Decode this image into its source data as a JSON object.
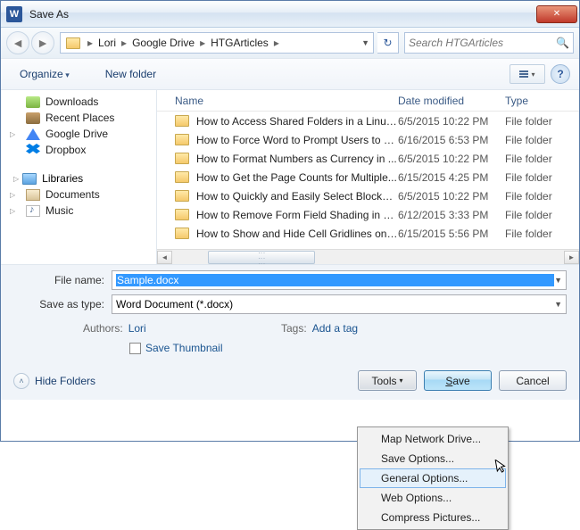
{
  "titlebar": {
    "title": "Save As",
    "app_glyph": "W"
  },
  "breadcrumb": [
    "Lori",
    "Google Drive",
    "HTGArticles"
  ],
  "search": {
    "placeholder": "Search HTGArticles"
  },
  "toolbar": {
    "organize": "Organize",
    "newfolder": "New folder"
  },
  "tree": {
    "top": [
      {
        "label": "Downloads",
        "icon": "dl"
      },
      {
        "label": "Recent Places",
        "icon": "recent"
      },
      {
        "label": "Google Drive",
        "icon": "gdrive"
      },
      {
        "label": "Dropbox",
        "icon": "dropbox"
      }
    ],
    "lib_header": "Libraries",
    "libs": [
      {
        "label": "Documents",
        "icon": "doc"
      },
      {
        "label": "Music",
        "icon": "music"
      }
    ]
  },
  "columns": {
    "name": "Name",
    "date": "Date modified",
    "type": "Type"
  },
  "files": [
    {
      "name": "How to Access Shared Folders in a Linux ...",
      "date": "6/5/2015 10:22 PM",
      "type": "File folder"
    },
    {
      "name": "How to Force Word to Prompt Users to O...",
      "date": "6/16/2015 6:53 PM",
      "type": "File folder"
    },
    {
      "name": "How to Format Numbers as Currency in ...",
      "date": "6/5/2015 10:22 PM",
      "type": "File folder"
    },
    {
      "name": "How to Get the Page Counts for Multiple...",
      "date": "6/15/2015 4:25 PM",
      "type": "File folder"
    },
    {
      "name": "How to Quickly and Easily Select Blocks ...",
      "date": "6/5/2015 10:22 PM",
      "type": "File folder"
    },
    {
      "name": "How to Remove Form Field Shading in W...",
      "date": "6/12/2015 3:33 PM",
      "type": "File folder"
    },
    {
      "name": "How to Show and Hide Cell Gridlines on ...",
      "date": "6/15/2015 5:56 PM",
      "type": "File folder"
    }
  ],
  "form": {
    "filename_label": "File name:",
    "filename_value": "Sample.docx",
    "saveastype_label": "Save as type:",
    "saveastype_value": "Word Document (*.docx)",
    "authors_label": "Authors:",
    "authors_value": "Lori",
    "tags_label": "Tags:",
    "tags_value": "Add a tag",
    "thumb_label": "Save Thumbnail"
  },
  "footer": {
    "hide": "Hide Folders",
    "tools": "Tools",
    "save": "Save",
    "cancel": "Cancel"
  },
  "menu": [
    "Map Network Drive...",
    "Save Options...",
    "General Options...",
    "Web Options...",
    "Compress Pictures..."
  ],
  "menu_hover_index": 2
}
